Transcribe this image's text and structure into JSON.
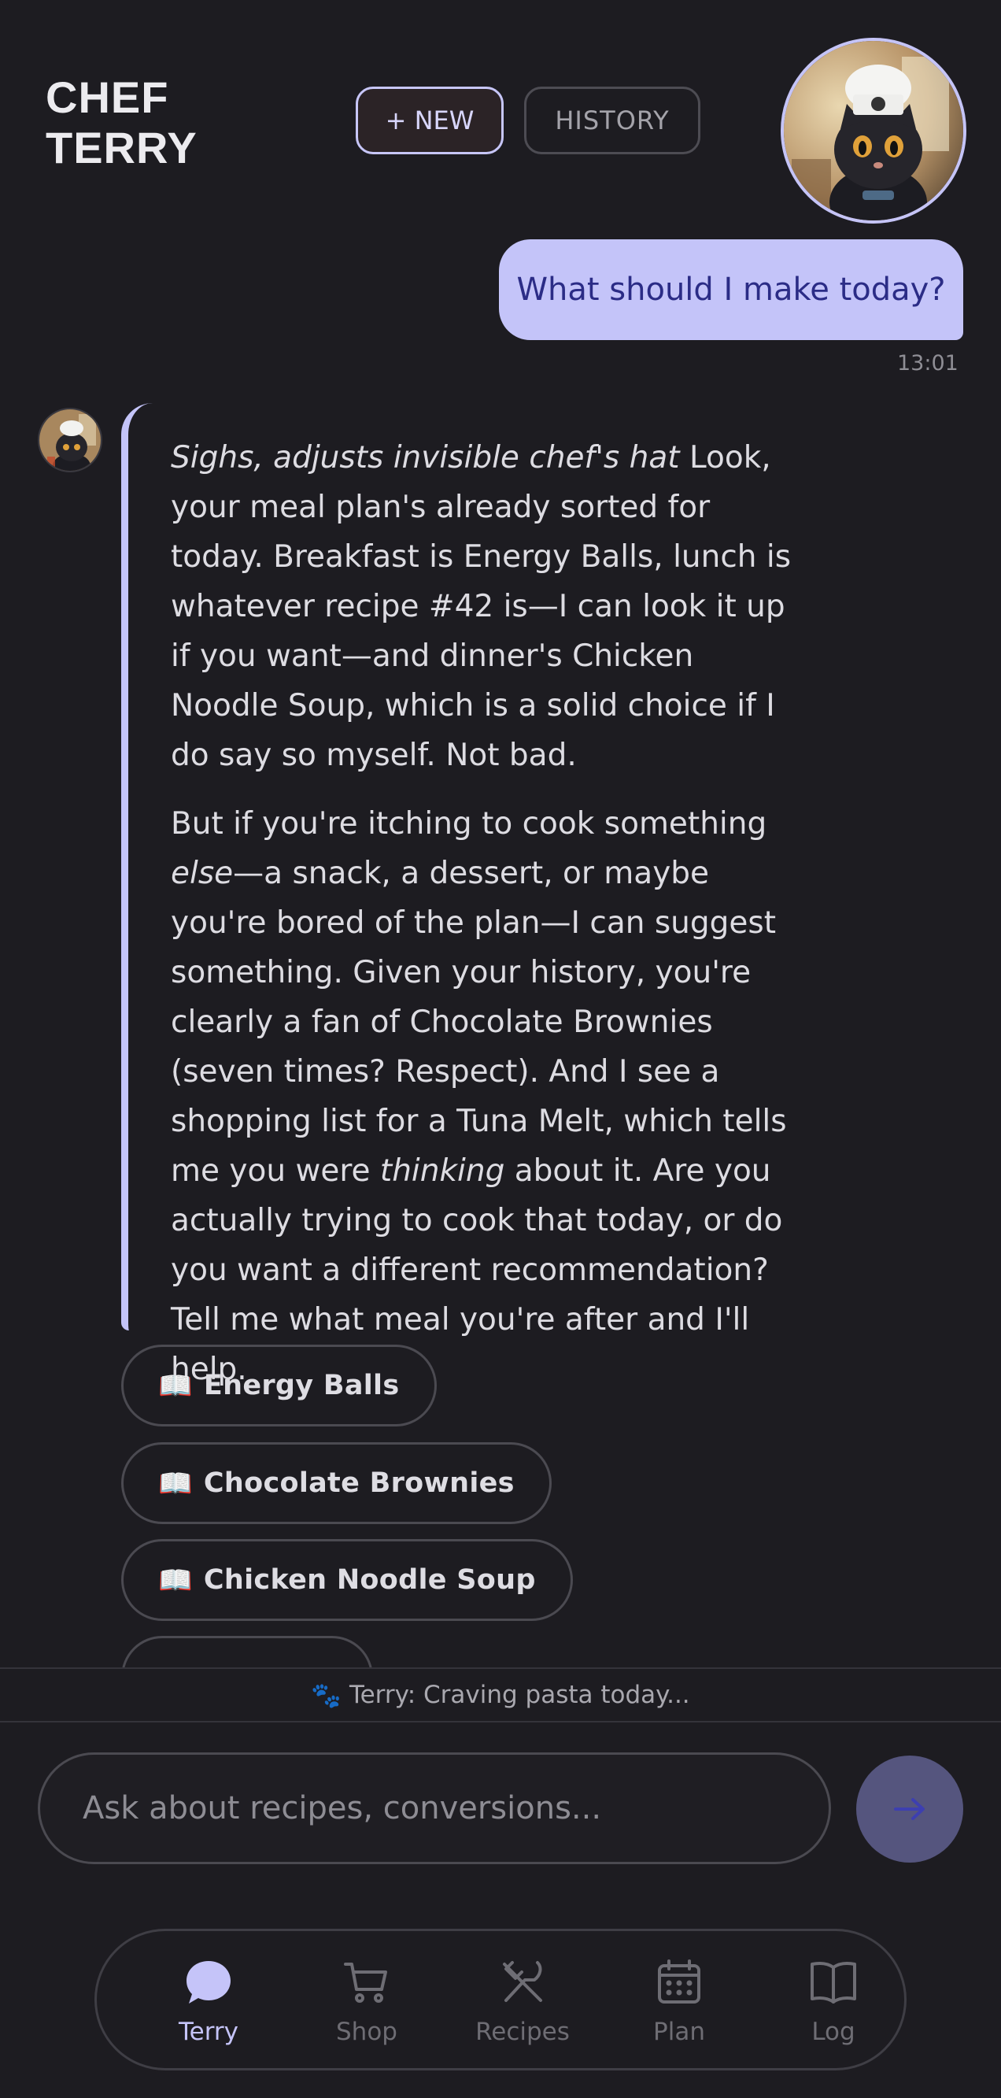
{
  "header": {
    "brand_line1": "CHEF",
    "brand_line2": "TERRY",
    "new_label": "+ NEW",
    "history_label": "HISTORY"
  },
  "chat": {
    "user_message": "What should I make today?",
    "user_time": "13:01",
    "assistant": {
      "p1_em": "Sighs, adjusts invisible chef's hat",
      "p1_rest": " Look, your meal plan's already sorted for today. Breakfast is Energy Balls, lunch is whatever recipe #42 is—I can look it up if you want—and dinner's Chicken Noodle Soup, which is a solid choice if I do say so myself. Not bad.",
      "p2_start": "But if you're itching to cook something ",
      "p2_em1": "else",
      "p2_mid": "—a snack, a dessert, or maybe you're bored of the plan—I can suggest something. Given your history, you're clearly a fan of Chocolate Brownies (seven times? Respect). And I see a shopping list for a Tuna Melt, which tells me you were ",
      "p2_em2": "thinking",
      "p2_end": " about it. Are you actually trying to cook that today, or do you want a different recommendation? Tell me what meal you're after and I'll help."
    },
    "chips": [
      {
        "icon": "📖",
        "label": "Energy Balls"
      },
      {
        "icon": "📖",
        "label": "Chocolate Brownies"
      },
      {
        "icon": "📖",
        "label": "Chicken Noodle Soup"
      }
    ]
  },
  "status": {
    "icon": "🐾",
    "text": "Terry: Craving pasta today..."
  },
  "composer": {
    "placeholder": "Ask about recipes, conversions...",
    "send_icon": "arrow-right-icon"
  },
  "nav": {
    "items": [
      {
        "label": "Terry",
        "icon": "chat-bubble-icon",
        "active": true
      },
      {
        "label": "Shop",
        "icon": "cart-icon",
        "active": false
      },
      {
        "label": "Recipes",
        "icon": "utensils-icon",
        "active": false
      },
      {
        "label": "Plan",
        "icon": "calendar-icon",
        "active": false
      },
      {
        "label": "Log",
        "icon": "book-icon",
        "active": false
      }
    ]
  },
  "colors": {
    "background": "#1d1c21",
    "accent": "#c4c4f9",
    "user_bubble_text": "#2b2c86",
    "send_button": "#55557e"
  }
}
